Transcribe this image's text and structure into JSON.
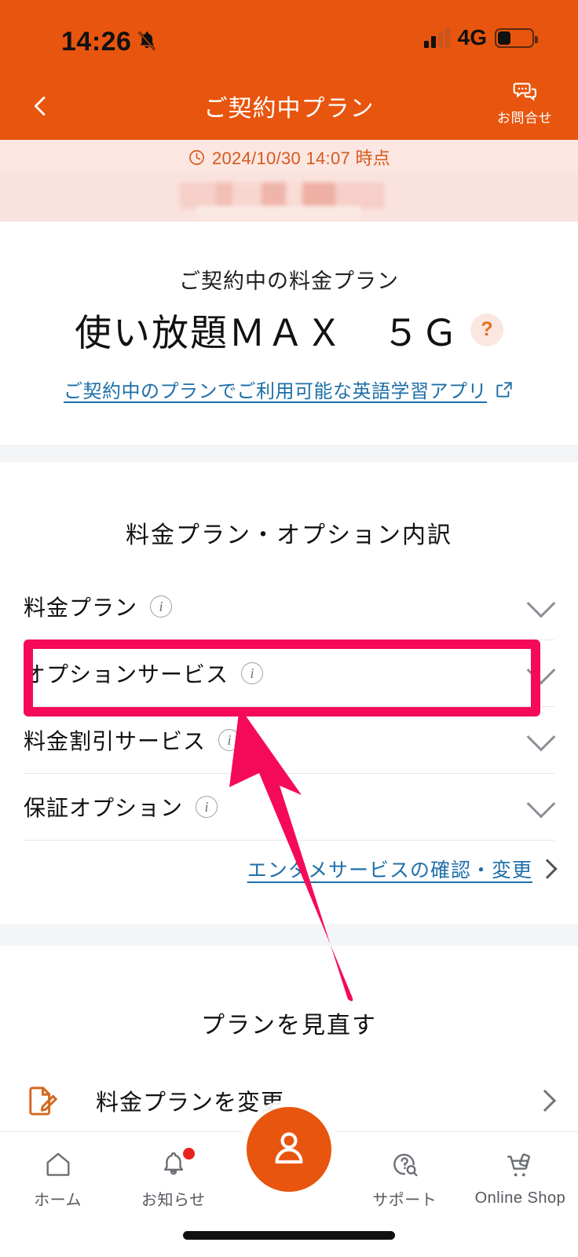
{
  "status_bar": {
    "time": "14:26",
    "mute_icon": "bell-slash-icon",
    "network": "4G",
    "signal_icon": "signal-bars-icon",
    "battery_icon": "battery-icon"
  },
  "nav": {
    "back_icon": "chevron-left-icon",
    "title": "ご契約中プラン",
    "contact_label": "お問合せ",
    "contact_icon": "chat-bubble-icon"
  },
  "timestamp_banner": {
    "clock_icon": "clock-icon",
    "text": "2024/10/30 14:07 時点"
  },
  "plan_card": {
    "label": "ご契約中の料金プラン",
    "name": "使い放題ＭＡＸ　５Ｇ",
    "help_badge": "?",
    "link_text": "ご契約中のプランでご利用可能な英語学習アプリ",
    "link_icon": "external-link-icon"
  },
  "breakdown": {
    "title": "料金プラン・オプション内訳",
    "rows": [
      {
        "label": "料金プラン",
        "info_icon": "info-icon",
        "chevron": "chevron-down-icon"
      },
      {
        "label": "オプションサービス",
        "info_icon": "info-icon",
        "chevron": "chevron-down-icon"
      },
      {
        "label": "料金割引サービス",
        "info_icon": "info-icon",
        "chevron": "chevron-down-icon"
      },
      {
        "label": "保証オプション",
        "info_icon": "info-icon",
        "chevron": "chevron-down-icon"
      }
    ],
    "entertainment_link": "エンタメサービスの確認・変更",
    "entertainment_chevron": "chevron-right-icon"
  },
  "review": {
    "title": "プランを見直す",
    "row_label": "料金プランを変更",
    "row_icon": "document-edit-icon",
    "row_chevron": "chevron-right-icon"
  },
  "tabbar": {
    "items": [
      {
        "label": "ホーム",
        "icon": "home-icon",
        "badge": false
      },
      {
        "label": "お知らせ",
        "icon": "bell-icon",
        "badge": true
      },
      {
        "label": "サポート",
        "icon": "question-search-icon",
        "badge": false
      },
      {
        "label": "Online Shop",
        "icon": "cart-phone-icon",
        "badge": false
      }
    ],
    "fab_icon": "person-icon"
  },
  "annotation": {
    "highlight_color": "#F50A5A",
    "arrow_color": "#F50A5A",
    "highlight_target": "オプションサービス"
  },
  "colors": {
    "header_orange": "#E8550E",
    "banner_pink": "#FBE6E1",
    "link_blue": "#1E6FA8",
    "section_gap": "#F4F5F7"
  }
}
